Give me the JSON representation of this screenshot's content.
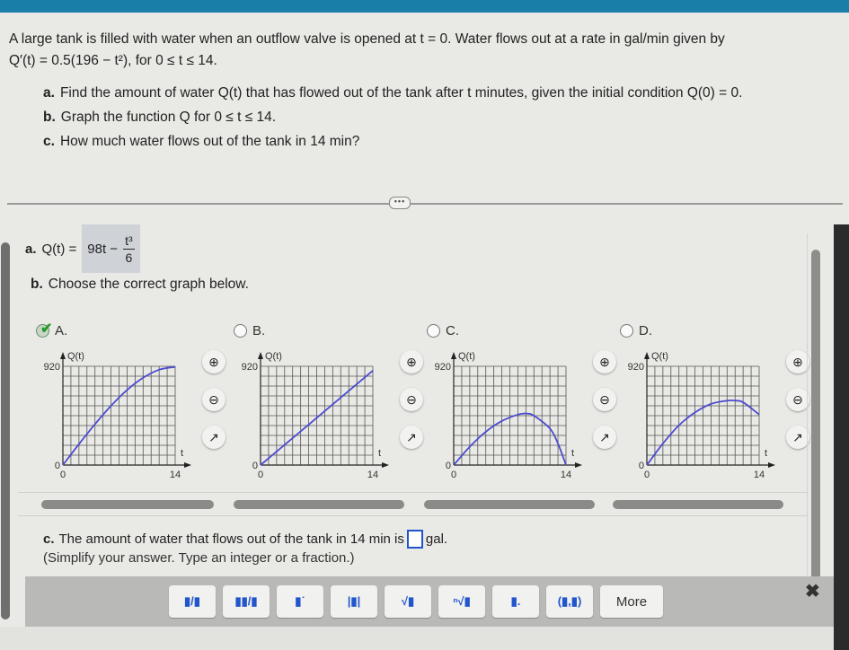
{
  "problem": {
    "intro": "A large tank is filled with water when an outflow valve is opened at t = 0. Water flows out at a rate in gal/min given by",
    "rate_function": "Q′(t) = 0.5(196 − t²), for 0 ≤ t ≤ 14.",
    "parts": [
      {
        "label": "a.",
        "text": "Find the amount of water Q(t) that has flowed out of the tank after t minutes, given the initial condition Q(0) = 0."
      },
      {
        "label": "b.",
        "text": "Graph the function Q for 0 ≤ t ≤ 14."
      },
      {
        "label": "c.",
        "text": "How much water flows out of the tank in 14 min?"
      }
    ]
  },
  "expand_button": "•••",
  "answer_a": {
    "label": "a.",
    "prefix": "Q(t) =",
    "value_lead": "98t −",
    "value_num": "t³",
    "value_den": "6"
  },
  "answer_b": {
    "label": "b.",
    "prompt": "Choose the correct graph below.",
    "selected": "A"
  },
  "options": [
    {
      "letter": "A.",
      "selected": true,
      "shape": "concave-increasing"
    },
    {
      "letter": "B.",
      "selected": false,
      "shape": "linear"
    },
    {
      "letter": "C.",
      "selected": false,
      "shape": "parabola-returns-to-zero"
    },
    {
      "letter": "D.",
      "selected": false,
      "shape": "peak-then-decline"
    }
  ],
  "graph_axes": {
    "ylabel": "Q(t)",
    "xlabel": "t",
    "ymax_label": "920",
    "y0_label": "0",
    "x0_label": "0",
    "xmax_label": "14"
  },
  "graph_tools": [
    "zoom-in-icon",
    "zoom-out-icon",
    "popout-icon"
  ],
  "answer_c": {
    "label": "c.",
    "text_before": "The amount of water that flows out of the tank in 14 min is",
    "input_value": "",
    "text_after": "gal.",
    "hint": "(Simplify your answer. Type an integer or a fraction.)"
  },
  "math_toolbar": {
    "buttons": [
      "fraction",
      "mixed-number",
      "exponent",
      "absolute-value",
      "square-root",
      "nth-root",
      "subscript",
      "ordered-pair"
    ],
    "button_glyphs": [
      "▮/▮",
      "▮▮/▮",
      "▮˙",
      "|▮|",
      "√▮",
      "ⁿ√▮",
      "▮.",
      "(▮,▮)"
    ],
    "more_label": "More",
    "close": "✖"
  },
  "chart_data": [
    {
      "type": "line",
      "title": "A.",
      "xlabel": "t",
      "ylabel": "Q(t)",
      "xlim": [
        0,
        14
      ],
      "ylim": [
        0,
        920
      ],
      "grid": true,
      "x": [
        0,
        2,
        4,
        6,
        8,
        10,
        12,
        14
      ],
      "y": [
        0,
        195,
        381,
        552,
        699,
        813,
        888,
        915
      ]
    },
    {
      "type": "line",
      "title": "B.",
      "xlabel": "t",
      "ylabel": "Q(t)",
      "xlim": [
        0,
        14
      ],
      "ylim": [
        0,
        920
      ],
      "grid": true,
      "x": [
        0,
        14
      ],
      "y": [
        0,
        880
      ]
    },
    {
      "type": "line",
      "title": "C.",
      "xlabel": "t",
      "ylabel": "Q(t)",
      "xlim": [
        0,
        14
      ],
      "ylim": [
        0,
        920
      ],
      "grid": true,
      "x": [
        0,
        2,
        4,
        6,
        8,
        9,
        10,
        12,
        13,
        14
      ],
      "y": [
        0,
        170,
        310,
        410,
        470,
        480,
        460,
        340,
        200,
        0
      ]
    },
    {
      "type": "line",
      "title": "D.",
      "xlabel": "t",
      "ylabel": "Q(t)",
      "xlim": [
        0,
        14
      ],
      "ylim": [
        0,
        920
      ],
      "grid": true,
      "x": [
        0,
        2,
        4,
        6,
        8,
        10,
        11,
        12,
        14
      ],
      "y": [
        0,
        200,
        370,
        490,
        570,
        600,
        600,
        585,
        470
      ]
    }
  ]
}
